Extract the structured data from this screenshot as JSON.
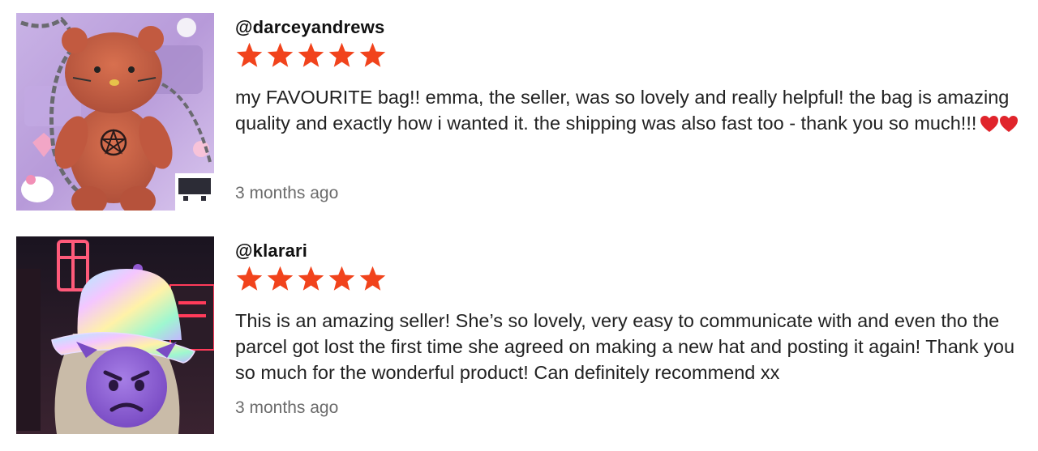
{
  "colors": {
    "star": "#f1431c",
    "heart": "#e0242b",
    "text": "#222222",
    "muted": "#6b6b6b"
  },
  "reviews": [
    {
      "username": "@darceyandrews",
      "rating": 5,
      "text": "my FAVOURITE bag!! emma, the seller, was so lovely and really helpful! the bag is amazing quality and exactly how i wanted it. the shipping was also fast too - thank you so much!!!",
      "emoji": "❤️❤️",
      "time": "3 months ago",
      "avatar_icon": "photo-avatar-bear-bag"
    },
    {
      "username": "@klarari",
      "rating": 5,
      "text": "This is an amazing seller! She’s so lovely, very easy to communicate with and even tho the parcel got lost the first time she agreed on making a new hat and posting it again! Thank you so much for the wonderful product! Can definitely recommend xx",
      "time": "3 months ago",
      "avatar_icon": "photo-avatar-bucket-hat"
    }
  ]
}
